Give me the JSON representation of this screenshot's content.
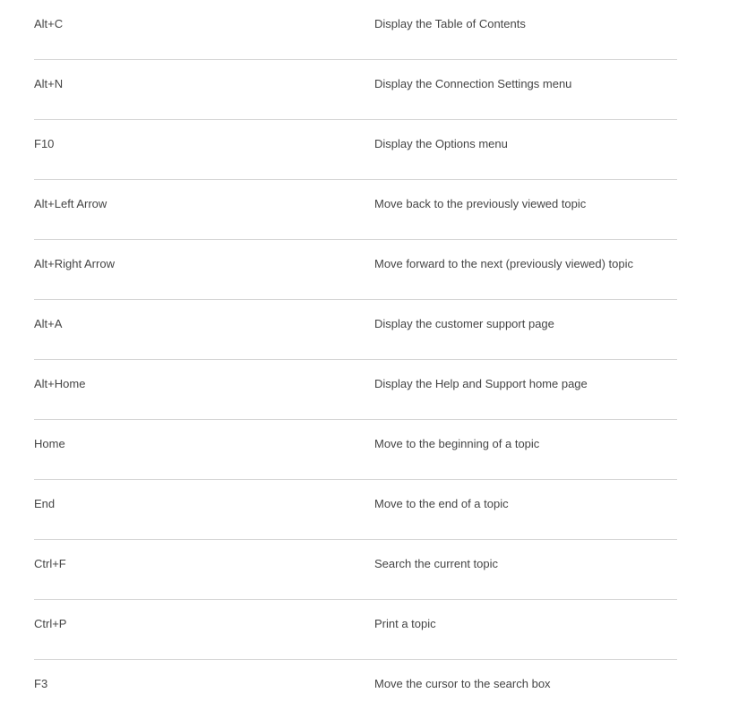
{
  "shortcuts": [
    {
      "key": "Alt+C",
      "description": "Display the Table of Contents"
    },
    {
      "key": "Alt+N",
      "description": "Display the Connection Settings menu"
    },
    {
      "key": "F10",
      "description": "Display the Options menu"
    },
    {
      "key": "Alt+Left Arrow",
      "description": "Move back to the previously viewed topic"
    },
    {
      "key": "Alt+Right Arrow",
      "description": "Move forward to the next (previously viewed) topic"
    },
    {
      "key": "Alt+A",
      "description": "Display the customer support page"
    },
    {
      "key": "Alt+Home",
      "description": "Display the Help and Support home page"
    },
    {
      "key": "Home",
      "description": "Move to the beginning of a topic"
    },
    {
      "key": "End",
      "description": "Move to the end of a topic"
    },
    {
      "key": "Ctrl+F",
      "description": "Search the current topic"
    },
    {
      "key": "Ctrl+P",
      "description": "Print a topic"
    },
    {
      "key": "F3",
      "description": "Move the cursor to the search box"
    }
  ]
}
